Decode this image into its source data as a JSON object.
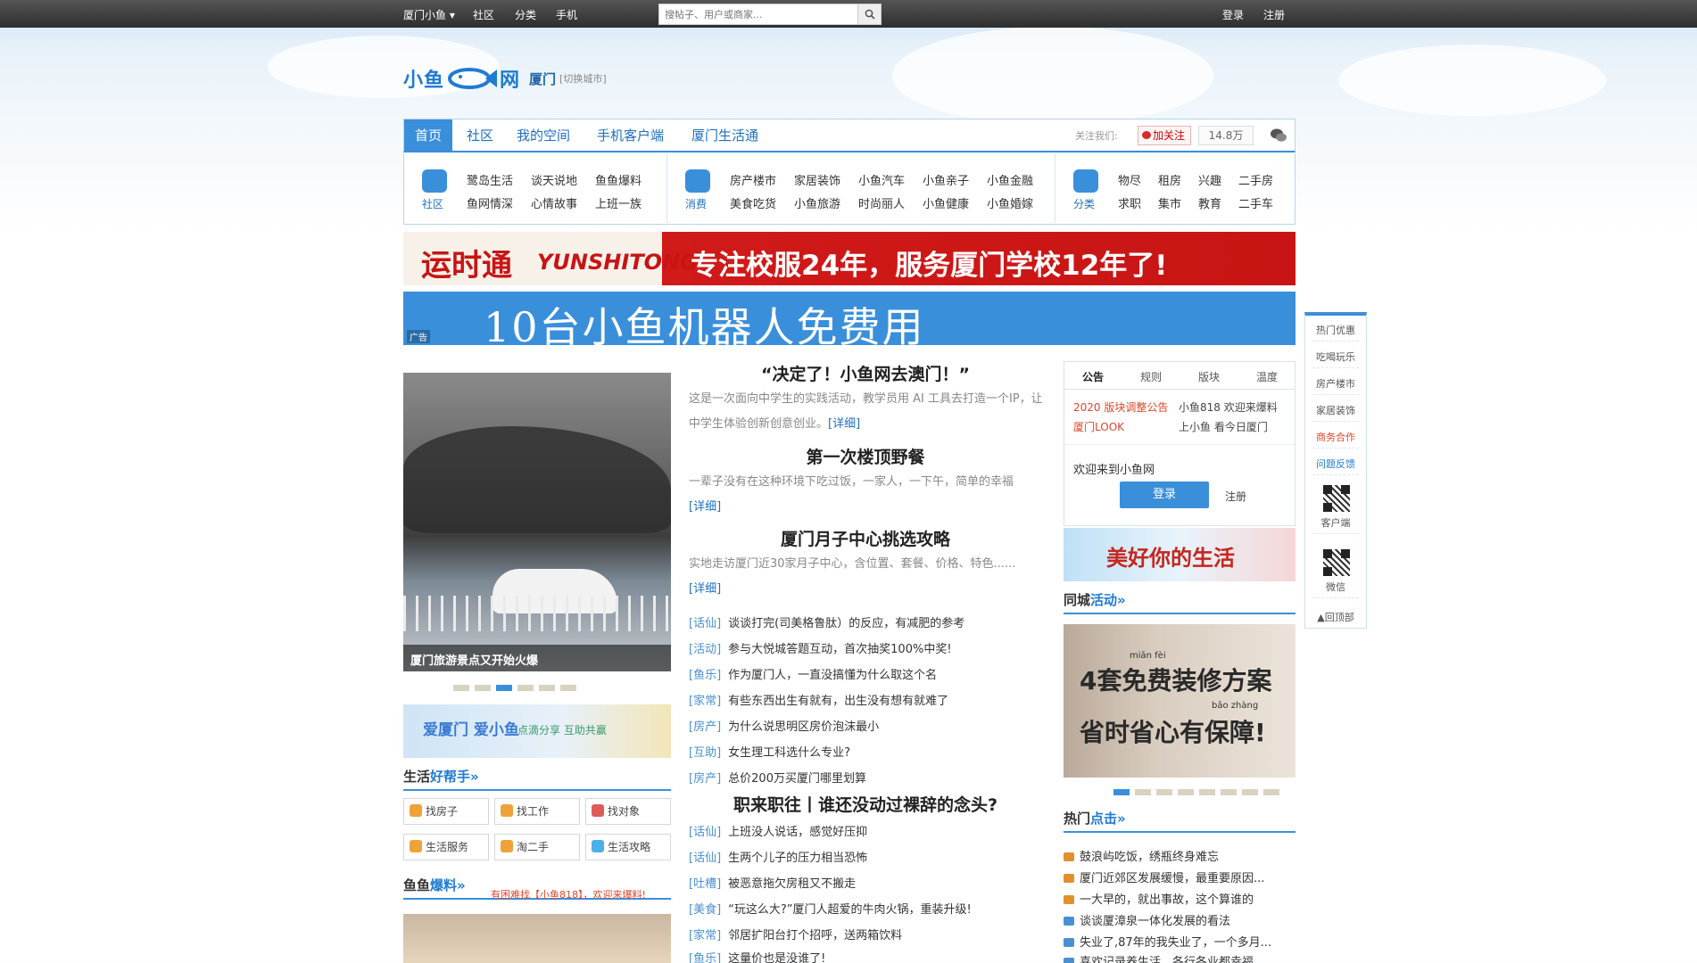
{
  "topbar": {
    "city": "厦门小鱼",
    "links": [
      "社区",
      "分类",
      "手机"
    ],
    "search_placeholder": "搜帖子、用户或商家...",
    "login": "登录",
    "register": "注册"
  },
  "logo": {
    "text_left": "小鱼",
    "text_right": "网",
    "city": "厦门",
    "switch": "[切换城市]"
  },
  "nav": {
    "tabs": [
      "首页",
      "社区",
      "我的空间",
      "手机客户端",
      "厦门生活通"
    ],
    "follow_label": "关注我们:",
    "weibo_button": "加关注",
    "weibo_count": "14.8万"
  },
  "categories": {
    "community": {
      "label": "社区",
      "links": [
        "鹭岛生活",
        "谈天说地",
        "鱼鱼爆料",
        "鱼网情深",
        "心情故事",
        "上班一族"
      ]
    },
    "consume": {
      "label": "消费",
      "links": [
        "房产楼市",
        "家居装饰",
        "小鱼汽车",
        "小鱼亲子",
        "小鱼金融",
        "美食吃货",
        "小鱼旅游",
        "时尚丽人",
        "小鱼健康",
        "小鱼婚嫁"
      ]
    },
    "classify": {
      "label": "分类",
      "links": [
        "物尽",
        "租房",
        "兴趣",
        "二手房",
        "求职",
        "集市",
        "教育",
        "二手车"
      ]
    }
  },
  "ads": {
    "banner1_brand": "运时通",
    "banner1_brand_en": "YUNSHITONG",
    "banner1_slogan": "专注校服24年，服务厦门学校12年了!",
    "banner2_text": "10台小鱼机器人免费用",
    "tag": "广告"
  },
  "left": {
    "photo_caption": "厦门旅游景点又开始火爆",
    "small_ad_title": "爱厦门 爱小鱼",
    "small_ad_sub": "点滴分享 互助共赢",
    "help_title_a": "生活",
    "help_title_b": "好帮手»",
    "help_buttons": [
      "找房子",
      "找工作",
      "找对象",
      "生活服务",
      "淘二手",
      "生活攻略"
    ],
    "yuyu_title_a": "鱼鱼",
    "yuyu_title_b": "爆料»",
    "yuyu_note": "有困难找【小鱼818】，欢迎来爆料!"
  },
  "middle": {
    "headline1": "“决定了！小鱼网去澳门！”",
    "summary1": "这是一次面向中学生的实践活动，教学员用 AI 工具去打造一个IP，让中学生体验创新创意创业。",
    "headline2": "第一次楼顶野餐",
    "summary2": "一辈子没有在这种环境下吃过饭，一家人，一下午，简单的幸福",
    "headline3": "厦门月子中心挑选攻略",
    "summary3": "实地走访厦门近30家月子中心，含位置、套餐、价格、特色......",
    "more": "[详细]",
    "news1": [
      {
        "tag": "[话仙]",
        "text": "谈谈打完(司美格鲁肽）的反应，有减肥的参考"
      },
      {
        "tag": "[活动]",
        "text": "参与大悦城答题互动，首次抽奖100%中奖!"
      },
      {
        "tag": "[鱼乐]",
        "text": "作为厦门人，一直没搞懂为什么取这个名"
      },
      {
        "tag": "[家常]",
        "text": "有些东西出生有就有，出生没有想有就难了"
      },
      {
        "tag": "[房产]",
        "text": "为什么说思明区房价泡沫最小"
      },
      {
        "tag": "[互助]",
        "text": "女生理工科选什么专业?"
      },
      {
        "tag": "[房产]",
        "text": "总价200万买厦门哪里划算"
      }
    ],
    "headline4": "职来职往丨谁还没动过裸辞的念头?",
    "news2": [
      {
        "tag": "[话仙]",
        "text": "上班没人说话，感觉好压抑"
      },
      {
        "tag": "[话仙]",
        "text": "生两个儿子的压力相当恐怖"
      },
      {
        "tag": "[吐槽]",
        "text": "被恶意拖欠房租又不搬走"
      },
      {
        "tag": "[美食]",
        "text": "“玩这么大?”厦门人超爱的牛肉火锅，重装升级!"
      },
      {
        "tag": "[家常]",
        "text": "邻居扩阳台打个招呼，送两箱饮料"
      },
      {
        "tag": "[鱼乐]",
        "text": "这量价也是没谁了!"
      }
    ]
  },
  "right": {
    "notice_tabs": [
      "公告",
      "规则",
      "版块",
      "温度"
    ],
    "notice_links": [
      "2020 版块调整公告",
      "小鱼818 欢迎来爆料",
      "厦门LOOK",
      "上小鱼 看今日厦门"
    ],
    "welcome": "欢迎来到小鱼网",
    "login_button": "登录",
    "register_link": "注册",
    "life_ad": "美好你的生活",
    "activity_title_a": "同城",
    "activity_title_b": "活动»",
    "deco_line1": "4套免费装修方案",
    "deco_line2": "省时省心有保障!",
    "deco_pinyin1": "miǎn fèi",
    "deco_pinyin2": "bǎo zhàng",
    "hot_title_a": "热门",
    "hot_title_b": "点击»",
    "hot_items": [
      "鼓浪屿吃饭，绣瓶终身难忘",
      "厦门近郊区发展缓慢，最重要原因...",
      "一大早的，就出事故，这个算谁的",
      "谈谈厦漳泉一体化发展的看法",
      "失业了,87年的我失业了，一个多月...",
      "喜欢记录养生活，各行各业都幸福"
    ]
  },
  "sidebar": {
    "items": [
      "热门优惠",
      "吃喝玩乐",
      "房产楼市",
      "家居装饰",
      "商务合作",
      "问题反馈"
    ],
    "client": "客户端",
    "wechat": "微信",
    "top": "▲回顶部"
  },
  "colors": {
    "brand": "#3a8fdb",
    "accent_red": "#c81414",
    "link_blue": "#1f6fbf"
  }
}
